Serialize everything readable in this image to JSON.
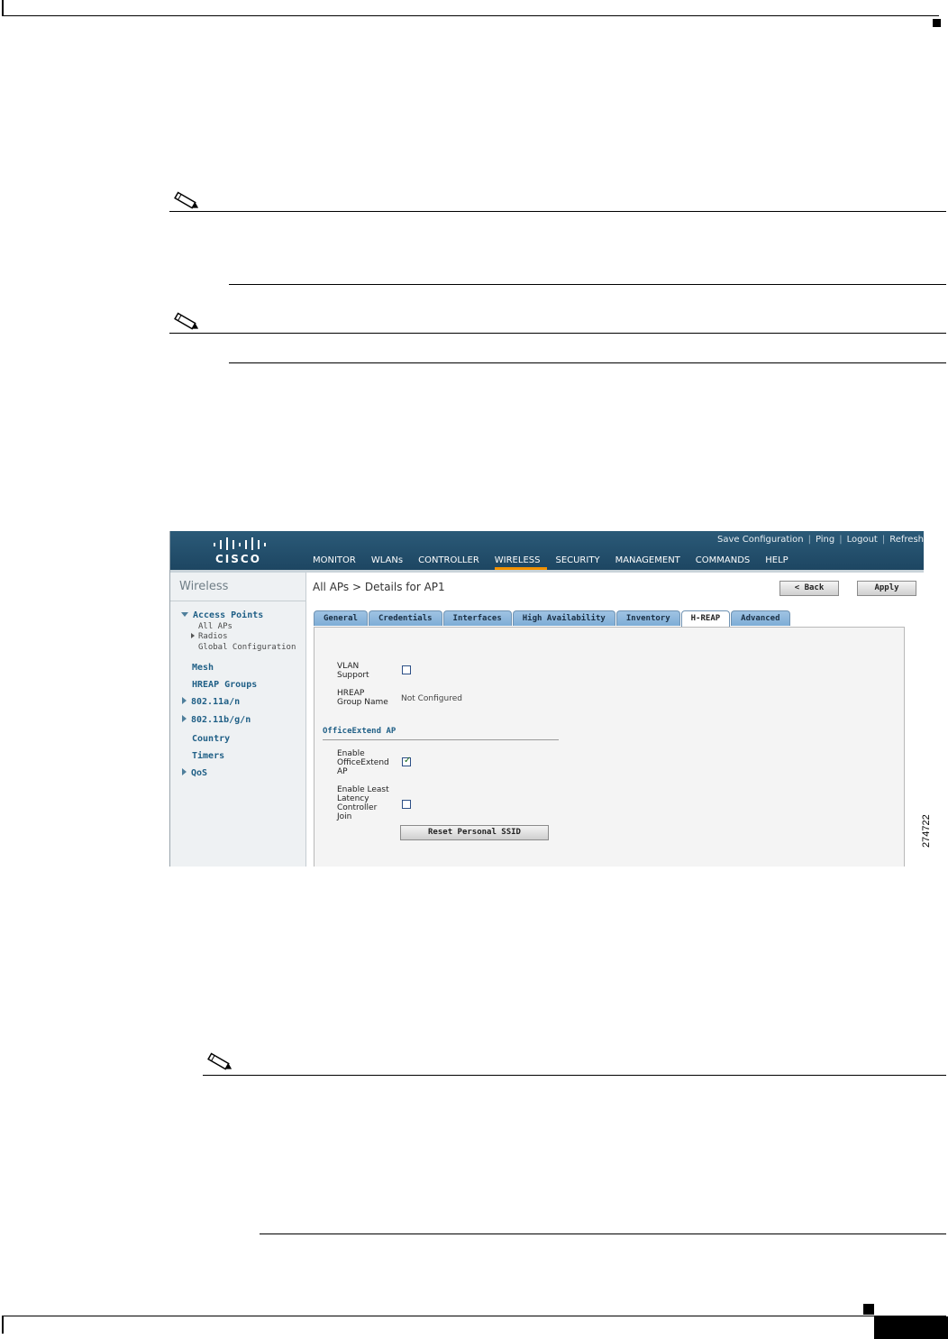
{
  "screenshot": {
    "top_links": [
      "Save Configuration",
      "Ping",
      "Logout",
      "Refresh"
    ],
    "logo": "CISCO",
    "nav_items": [
      "MONITOR",
      "WLANs",
      "CONTROLLER",
      "WIRELESS",
      "SECURITY",
      "MANAGEMENT",
      "COMMANDS",
      "HELP"
    ],
    "active_nav": "WIRELESS",
    "sidebar": {
      "title": "Wireless",
      "access_points": "Access Points",
      "all_aps": "All APs",
      "radios": "Radios",
      "global_configuration": "Global Configuration",
      "mesh": "Mesh",
      "hreap_groups": "HREAP Groups",
      "b80211an": "802.11a/n",
      "b80211bgn": "802.11b/g/n",
      "country": "Country",
      "timers": "Timers",
      "qos": "QoS"
    },
    "page_title": "All APs > Details for AP1",
    "back_button": "< Back",
    "apply_button": "Apply",
    "tabs": [
      "General",
      "Credentials",
      "Interfaces",
      "High Availability",
      "Inventory",
      "H-REAP",
      "Advanced"
    ],
    "active_tab": "H-REAP",
    "form": {
      "vlan_label_1": "VLAN",
      "vlan_label_2": "Support",
      "vlan_support_checked": false,
      "hreap_label_1": "HREAP",
      "hreap_label_2": "Group Name",
      "hreap_value": "Not Configured",
      "section_title": "OfficeExtend AP",
      "oe_label_1": "Enable",
      "oe_label_2": "OfficeExtend",
      "oe_label_3": "AP",
      "oe_checked": true,
      "ll_label_1": "Enable Least",
      "ll_label_2": "Latency",
      "ll_label_3": "Controller",
      "ll_label_4": "Join",
      "ll_checked": false,
      "reset_button": "Reset Personal SSID"
    }
  },
  "figure_id": "274722"
}
